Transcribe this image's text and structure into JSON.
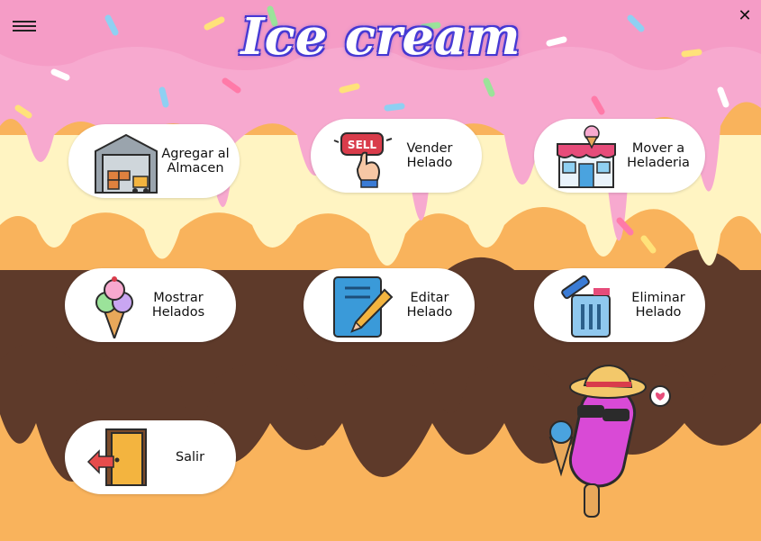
{
  "app": {
    "title": "Ice cream"
  },
  "window": {
    "menu_icon": "hamburger-menu-icon",
    "close_label": "✕"
  },
  "buttons": [
    {
      "id": "agregar",
      "label": "Agregar al\nAlmacen",
      "icon": "warehouse-icon"
    },
    {
      "id": "vender",
      "label": "Vender\nHelado",
      "icon": "sell-button-hand-icon"
    },
    {
      "id": "mover",
      "label": "Mover a\nHeladeria",
      "icon": "ice-cream-shop-icon"
    },
    {
      "id": "mostrar",
      "label": "Mostrar\nHelados",
      "icon": "ice-cream-cone-icon"
    },
    {
      "id": "editar",
      "label": "Editar\nHelado",
      "icon": "edit-notebook-pencil-icon"
    },
    {
      "id": "eliminar",
      "label": "Eliminar\nHelado",
      "icon": "trash-can-icon"
    },
    {
      "id": "salir",
      "label": "Salir",
      "icon": "exit-door-icon"
    }
  ],
  "colors": {
    "pink": "#f7a9cf",
    "cream": "#fff4c2",
    "chocolate": "#5e3a2a",
    "orange": "#f9b35c",
    "title_outline": "#3c2fc9"
  }
}
